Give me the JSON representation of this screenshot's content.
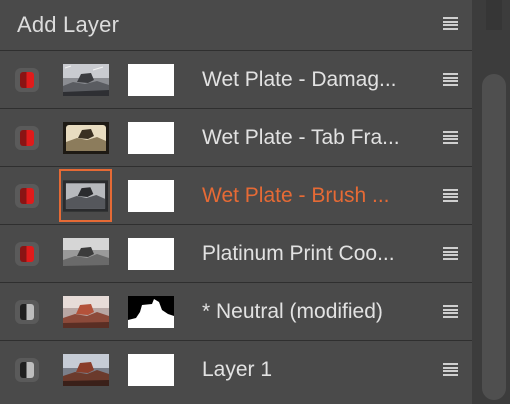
{
  "panel": {
    "title": "Add Layer"
  },
  "layers": [
    {
      "name": "Wet Plate - Damag...",
      "toggle": "red",
      "mask": "white",
      "thumb": "damaged"
    },
    {
      "name": "Wet Plate - Tab Fra...",
      "toggle": "red",
      "mask": "white",
      "thumb": "tab"
    },
    {
      "name": "Wet Plate - Brush ...",
      "toggle": "red",
      "mask": "white",
      "thumb": "brush",
      "selected": true
    },
    {
      "name": "Platinum Print Coo...",
      "toggle": "red",
      "mask": "white",
      "thumb": "platinum"
    },
    {
      "name": "* Neutral (modified)",
      "toggle": "gray",
      "mask": "rock-silhouette",
      "thumb": "color-rock"
    },
    {
      "name": "Layer 1",
      "toggle": "gray",
      "mask": "white",
      "thumb": "color-rock-2"
    }
  ],
  "icons": {
    "menu": "menu-icon",
    "toggle": "layer-toggle-icon"
  },
  "colors": {
    "accent": "#e66a35",
    "toggle_on": "#e01b1b",
    "panel_bg": "#4a4a4a"
  }
}
